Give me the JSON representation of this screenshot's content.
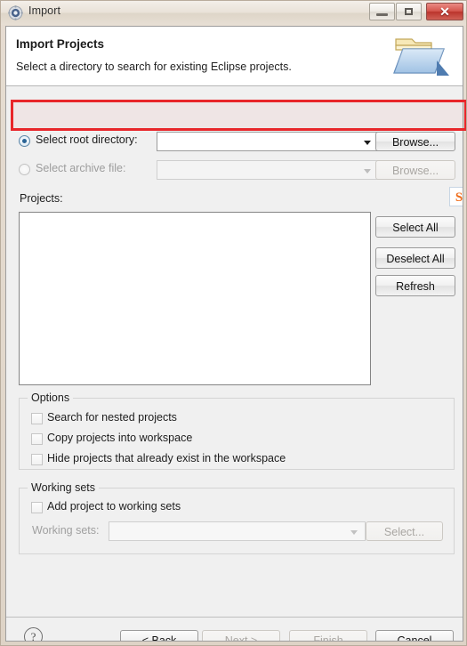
{
  "window": {
    "title": "Import",
    "icon": "eclipse-import-icon",
    "controls": {
      "minimize": "minimize-icon",
      "maximize": "restore-icon",
      "close": "✕"
    }
  },
  "header": {
    "title": "Import Projects",
    "description": "Select a directory to search for existing Eclipse projects.",
    "icon": "open-folder-icon"
  },
  "source": {
    "root": {
      "label": "Select root directory:",
      "selected": true,
      "value": "",
      "placeholder": "",
      "browse_label": "Browse..."
    },
    "archive": {
      "label": "Select archive file:",
      "selected": false,
      "value": "",
      "placeholder": "",
      "browse_label": "Browse..."
    }
  },
  "projects": {
    "label": "Projects:",
    "items": [],
    "buttons": {
      "select_all": "Select All",
      "deselect_all": "Deselect All",
      "refresh": "Refresh"
    },
    "overlay_logo": "sogou-s-logo-icon"
  },
  "options": {
    "title": "Options",
    "checkboxes": [
      {
        "label": "Search for nested projects",
        "checked": false
      },
      {
        "label": "Copy projects into workspace",
        "checked": false
      },
      {
        "label": "Hide projects that already exist in the workspace",
        "checked": false
      }
    ]
  },
  "working_sets": {
    "title": "Working sets",
    "add_checkbox": {
      "label": "Add project to working sets",
      "checked": false
    },
    "combo_label": "Working sets:",
    "combo_value": "",
    "select_label": "Select...",
    "enabled": false
  },
  "footer": {
    "help": "?",
    "buttons": {
      "back": "< Back",
      "next": "Next >",
      "finish": "Finish",
      "cancel": "Cancel"
    }
  },
  "annotation": {
    "highlight_color": "#e8262a",
    "target": "select-root-directory-row"
  }
}
